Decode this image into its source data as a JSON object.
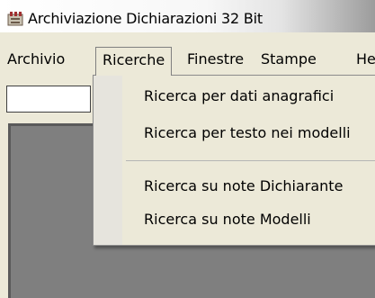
{
  "window": {
    "title": "Archiviazione Dichiarazioni 32 Bit"
  },
  "menubar": {
    "items": [
      {
        "label": "Archivio"
      },
      {
        "label": "Ricerche"
      },
      {
        "label": "Finestre"
      },
      {
        "label": "Stampe"
      },
      {
        "label": "He"
      }
    ]
  },
  "ricerche_menu": {
    "items": [
      {
        "label": "Ricerca per dati anagrafici"
      },
      {
        "label": "Ricerca per testo nei modelli"
      },
      {
        "label": "Ricerca su note Dichiarante"
      },
      {
        "label": "Ricerca su note Modelli"
      }
    ]
  }
}
